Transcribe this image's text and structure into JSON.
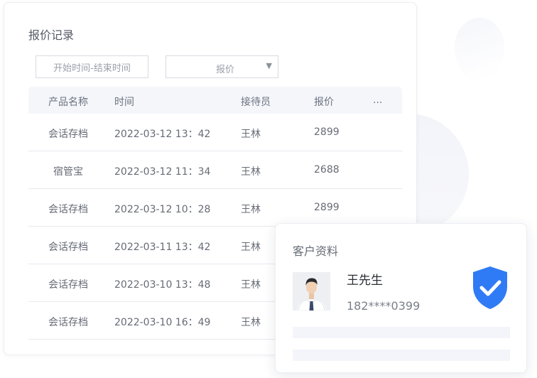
{
  "quote_panel": {
    "title": "报价记录",
    "date_range_placeholder": "开始时间-结束时间",
    "price_select": "报价",
    "columns": [
      "产品名称",
      "时间",
      "接待员",
      "报价",
      "..."
    ],
    "rows": [
      {
        "product": "会话存档",
        "time": "2022-03-12 13：42",
        "staff": "王林",
        "price": "2899"
      },
      {
        "product": "宿管宝",
        "time": "2022-03-12 11：34",
        "staff": "王林",
        "price": "2688"
      },
      {
        "product": "会话存档",
        "time": "2022-03-12 10：28",
        "staff": "王林",
        "price": "2899"
      },
      {
        "product": "会话存档",
        "time": "2022-03-11 13：42",
        "staff": "王林",
        "price": ""
      },
      {
        "product": "会话存档",
        "time": "2022-03-10 13：48",
        "staff": "王林",
        "price": ""
      },
      {
        "product": "会话存档",
        "time": "2022-03-10 16：49",
        "staff": "王林",
        "price": ""
      }
    ]
  },
  "customer_card": {
    "title": "客户资料",
    "name": "王先生",
    "phone": "182****0399",
    "verified_icon": "shield-check-icon",
    "accent_color": "#2f7bf5"
  }
}
